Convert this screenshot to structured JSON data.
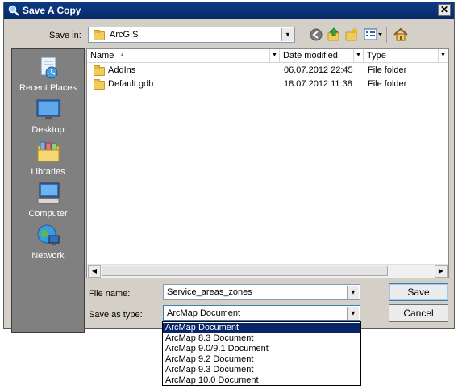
{
  "window": {
    "title": "Save A Copy",
    "close_glyph": "✕"
  },
  "toolbar": {
    "save_in_label": "Save in:",
    "current_folder": "ArcGIS",
    "icons": [
      "back-icon",
      "up-folder-icon",
      "new-folder-icon",
      "view-menu-icon",
      "home-icon"
    ]
  },
  "places": [
    {
      "label": "Recent Places",
      "icon": "recent-places-icon"
    },
    {
      "label": "Desktop",
      "icon": "desktop-icon"
    },
    {
      "label": "Libraries",
      "icon": "libraries-icon"
    },
    {
      "label": "Computer",
      "icon": "computer-icon"
    },
    {
      "label": "Network",
      "icon": "network-icon"
    }
  ],
  "filelist": {
    "columns": [
      "Name",
      "Date modified",
      "Type"
    ],
    "rows": [
      {
        "name": "AddIns",
        "date": "06.07.2012 22:45",
        "type": "File folder"
      },
      {
        "name": "Default.gdb",
        "date": "18.07.2012 11:38",
        "type": "File folder"
      }
    ]
  },
  "form": {
    "file_name_label": "File name:",
    "file_name_value": "Service_areas_zones",
    "save_as_type_label": "Save as type:",
    "save_as_type_value": "ArcMap Document",
    "save_button": "Save",
    "cancel_button": "Cancel"
  },
  "type_options": [
    "ArcMap Document",
    "ArcMap 8.3 Document",
    "ArcMap 9.0/9.1 Document",
    "ArcMap 9.2 Document",
    "ArcMap 9.3 Document",
    "ArcMap 10.0 Document"
  ],
  "colors": {
    "title_bar": "#0a246a",
    "selection": "#0a246a",
    "dialog_face": "#d4d0c8",
    "places_bar": "#808080"
  }
}
